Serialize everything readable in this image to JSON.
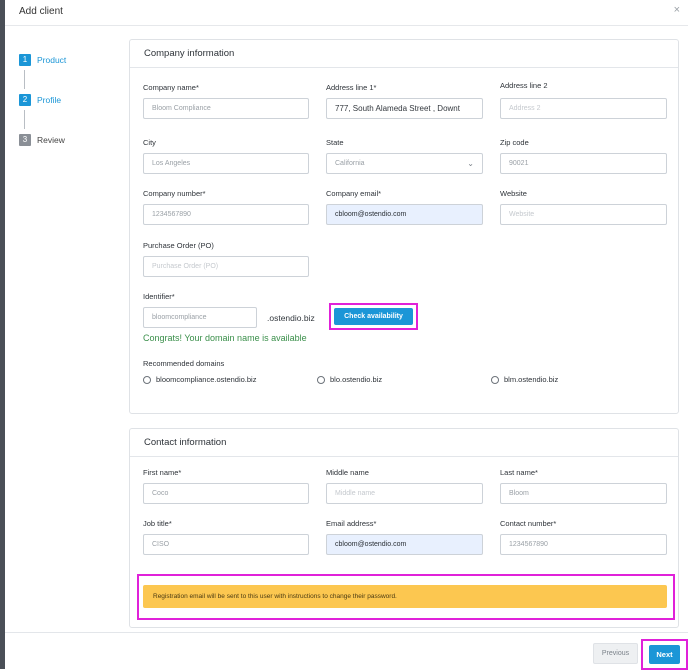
{
  "dialog": {
    "title": "Add client",
    "close_glyph": "×"
  },
  "stepper": [
    {
      "num": "1",
      "label": "Product",
      "state": "active"
    },
    {
      "num": "2",
      "label": "Profile",
      "state": "active"
    },
    {
      "num": "3",
      "label": "Review",
      "state": "inactive"
    }
  ],
  "company": {
    "heading": "Company information",
    "company_name": {
      "label": "Company name*",
      "value": "Bloom Compliance"
    },
    "address1": {
      "label": "Address line 1*",
      "value": "777, South Alameda Street , Downt"
    },
    "address2": {
      "label": "Address line 2",
      "placeholder": "Address 2"
    },
    "city": {
      "label": "City",
      "value": "Los Angeles"
    },
    "state": {
      "label": "State",
      "value": "California"
    },
    "zip": {
      "label": "Zip code",
      "value": "90021"
    },
    "company_number": {
      "label": "Company number*",
      "value": "1234567890"
    },
    "company_email": {
      "label": "Company email*",
      "value": "cbloom@ostendio.com"
    },
    "website": {
      "label": "Website",
      "placeholder": "Website"
    },
    "po": {
      "label": "Purchase Order (PO)",
      "placeholder": "Purchase Order (PO)"
    },
    "identifier": {
      "label": "Identifier*",
      "value": "bloomcompliance",
      "suffix": ".ostendio.biz"
    },
    "check_button": "Check availability",
    "success_message": "Congrats! Your domain name is available",
    "recommended_label": "Recommended domains",
    "recommended": [
      "bloomcompliance.ostendio.biz",
      "blo.ostendio.biz",
      "blm.ostendio.biz"
    ]
  },
  "contact": {
    "heading": "Contact information",
    "first_name": {
      "label": "First name*",
      "value": "Coco"
    },
    "middle_name": {
      "label": "Middle name",
      "placeholder": "Middle name"
    },
    "last_name": {
      "label": "Last name*",
      "value": "Bloom"
    },
    "job_title": {
      "label": "Job title*",
      "value": "CISO"
    },
    "email": {
      "label": "Email address*",
      "value": "cbloom@ostendio.com"
    },
    "contact_number": {
      "label": "Contact number*",
      "value": "1234567890"
    }
  },
  "notice": "Registration email will be sent to this user with instructions to change their password.",
  "footer": {
    "previous_label": "Previous",
    "next_label": "Next"
  },
  "colors": {
    "primary": "#1b96d7",
    "highlight": "#e021d9",
    "warning": "#fcc750",
    "success": "#3a8f4a",
    "autofill": "#e8f0fe"
  }
}
